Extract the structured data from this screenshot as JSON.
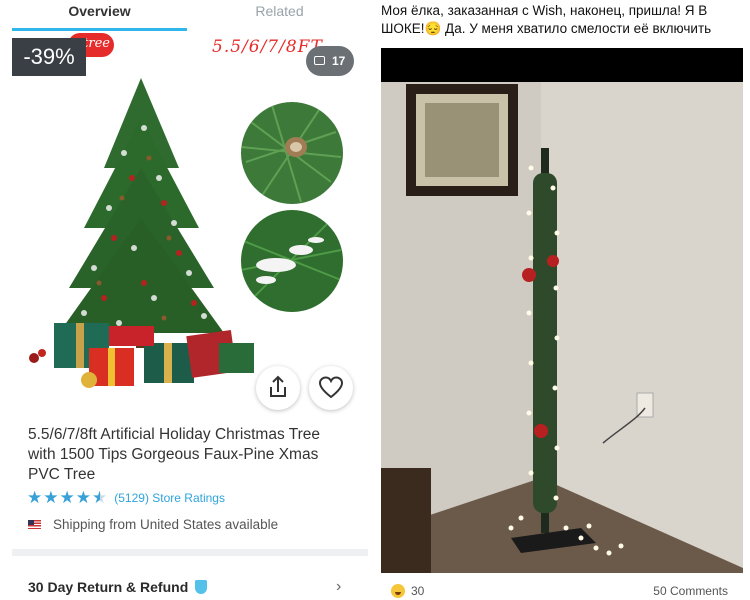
{
  "tabs": {
    "overview": "Overview",
    "related": "Related"
  },
  "gallery": {
    "discount": "-39%",
    "badge_text": "tree",
    "sizes_overlay": "5.5/6/7/8FT",
    "photo_count": "17"
  },
  "product": {
    "title": "5.5/6/7/8ft Artificial Holiday Christmas Tree with 1500 Tips Gorgeous Faux-Pine Xmas PVC Tree",
    "rating": 4.5,
    "ratings_text": "(5129) Store Ratings",
    "shipping": "Shipping from United States available",
    "refund": "30 Day Return & Refund"
  },
  "post": {
    "caption": "Моя ёлка, заказанная с Wish, наконец, пришла! Я В ШОКЕ!😔 Да. У меня хватило смелости её включить",
    "reactions_count": "30",
    "comments": "50 Comments"
  },
  "colors": {
    "accent": "#2fb7ec",
    "discount_bg": "#3a3f45",
    "brand_red": "#e62b2b",
    "star": "#3aa0d8"
  }
}
